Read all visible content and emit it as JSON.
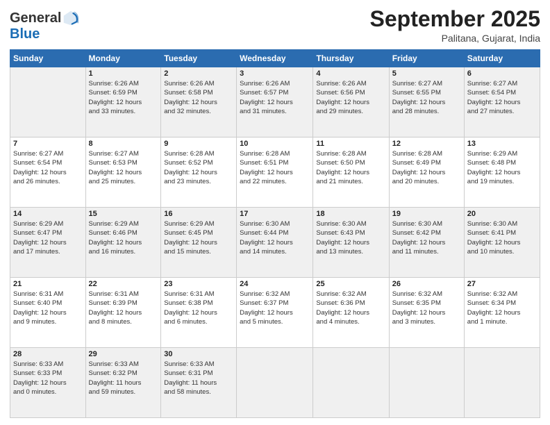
{
  "header": {
    "logo_general": "General",
    "logo_blue": "Blue",
    "title": "September 2025",
    "location": "Palitana, Gujarat, India"
  },
  "weekdays": [
    "Sunday",
    "Monday",
    "Tuesday",
    "Wednesday",
    "Thursday",
    "Friday",
    "Saturday"
  ],
  "weeks": [
    [
      {
        "date": "",
        "info": ""
      },
      {
        "date": "1",
        "info": "Sunrise: 6:26 AM\nSunset: 6:59 PM\nDaylight: 12 hours\nand 33 minutes."
      },
      {
        "date": "2",
        "info": "Sunrise: 6:26 AM\nSunset: 6:58 PM\nDaylight: 12 hours\nand 32 minutes."
      },
      {
        "date": "3",
        "info": "Sunrise: 6:26 AM\nSunset: 6:57 PM\nDaylight: 12 hours\nand 31 minutes."
      },
      {
        "date": "4",
        "info": "Sunrise: 6:26 AM\nSunset: 6:56 PM\nDaylight: 12 hours\nand 29 minutes."
      },
      {
        "date": "5",
        "info": "Sunrise: 6:27 AM\nSunset: 6:55 PM\nDaylight: 12 hours\nand 28 minutes."
      },
      {
        "date": "6",
        "info": "Sunrise: 6:27 AM\nSunset: 6:54 PM\nDaylight: 12 hours\nand 27 minutes."
      }
    ],
    [
      {
        "date": "7",
        "info": "Sunrise: 6:27 AM\nSunset: 6:54 PM\nDaylight: 12 hours\nand 26 minutes."
      },
      {
        "date": "8",
        "info": "Sunrise: 6:27 AM\nSunset: 6:53 PM\nDaylight: 12 hours\nand 25 minutes."
      },
      {
        "date": "9",
        "info": "Sunrise: 6:28 AM\nSunset: 6:52 PM\nDaylight: 12 hours\nand 23 minutes."
      },
      {
        "date": "10",
        "info": "Sunrise: 6:28 AM\nSunset: 6:51 PM\nDaylight: 12 hours\nand 22 minutes."
      },
      {
        "date": "11",
        "info": "Sunrise: 6:28 AM\nSunset: 6:50 PM\nDaylight: 12 hours\nand 21 minutes."
      },
      {
        "date": "12",
        "info": "Sunrise: 6:28 AM\nSunset: 6:49 PM\nDaylight: 12 hours\nand 20 minutes."
      },
      {
        "date": "13",
        "info": "Sunrise: 6:29 AM\nSunset: 6:48 PM\nDaylight: 12 hours\nand 19 minutes."
      }
    ],
    [
      {
        "date": "14",
        "info": "Sunrise: 6:29 AM\nSunset: 6:47 PM\nDaylight: 12 hours\nand 17 minutes."
      },
      {
        "date": "15",
        "info": "Sunrise: 6:29 AM\nSunset: 6:46 PM\nDaylight: 12 hours\nand 16 minutes."
      },
      {
        "date": "16",
        "info": "Sunrise: 6:29 AM\nSunset: 6:45 PM\nDaylight: 12 hours\nand 15 minutes."
      },
      {
        "date": "17",
        "info": "Sunrise: 6:30 AM\nSunset: 6:44 PM\nDaylight: 12 hours\nand 14 minutes."
      },
      {
        "date": "18",
        "info": "Sunrise: 6:30 AM\nSunset: 6:43 PM\nDaylight: 12 hours\nand 13 minutes."
      },
      {
        "date": "19",
        "info": "Sunrise: 6:30 AM\nSunset: 6:42 PM\nDaylight: 12 hours\nand 11 minutes."
      },
      {
        "date": "20",
        "info": "Sunrise: 6:30 AM\nSunset: 6:41 PM\nDaylight: 12 hours\nand 10 minutes."
      }
    ],
    [
      {
        "date": "21",
        "info": "Sunrise: 6:31 AM\nSunset: 6:40 PM\nDaylight: 12 hours\nand 9 minutes."
      },
      {
        "date": "22",
        "info": "Sunrise: 6:31 AM\nSunset: 6:39 PM\nDaylight: 12 hours\nand 8 minutes."
      },
      {
        "date": "23",
        "info": "Sunrise: 6:31 AM\nSunset: 6:38 PM\nDaylight: 12 hours\nand 6 minutes."
      },
      {
        "date": "24",
        "info": "Sunrise: 6:32 AM\nSunset: 6:37 PM\nDaylight: 12 hours\nand 5 minutes."
      },
      {
        "date": "25",
        "info": "Sunrise: 6:32 AM\nSunset: 6:36 PM\nDaylight: 12 hours\nand 4 minutes."
      },
      {
        "date": "26",
        "info": "Sunrise: 6:32 AM\nSunset: 6:35 PM\nDaylight: 12 hours\nand 3 minutes."
      },
      {
        "date": "27",
        "info": "Sunrise: 6:32 AM\nSunset: 6:34 PM\nDaylight: 12 hours\nand 1 minute."
      }
    ],
    [
      {
        "date": "28",
        "info": "Sunrise: 6:33 AM\nSunset: 6:33 PM\nDaylight: 12 hours\nand 0 minutes."
      },
      {
        "date": "29",
        "info": "Sunrise: 6:33 AM\nSunset: 6:32 PM\nDaylight: 11 hours\nand 59 minutes."
      },
      {
        "date": "30",
        "info": "Sunrise: 6:33 AM\nSunset: 6:31 PM\nDaylight: 11 hours\nand 58 minutes."
      },
      {
        "date": "",
        "info": ""
      },
      {
        "date": "",
        "info": ""
      },
      {
        "date": "",
        "info": ""
      },
      {
        "date": "",
        "info": ""
      }
    ]
  ]
}
